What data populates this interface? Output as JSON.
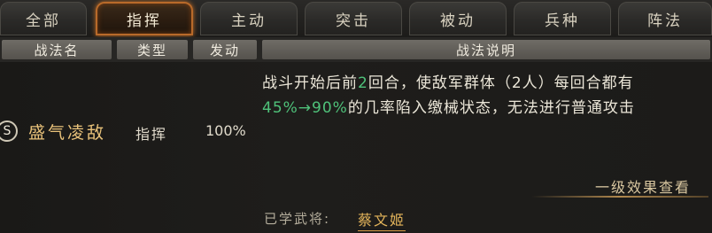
{
  "tabs": [
    {
      "label": "全部",
      "active": false
    },
    {
      "label": "指挥",
      "active": true
    },
    {
      "label": "主动",
      "active": false
    },
    {
      "label": "突击",
      "active": false
    },
    {
      "label": "被动",
      "active": false
    },
    {
      "label": "兵种",
      "active": false
    },
    {
      "label": "阵法",
      "active": false
    }
  ],
  "columns": {
    "name": "战法名",
    "type": "类型",
    "rate": "发动",
    "description": "战法说明"
  },
  "skill": {
    "grade": "S",
    "name": "盛气凌敌",
    "type": "指挥",
    "rate": "100%",
    "description": {
      "line1": "战斗开始后前",
      "rounds": "2",
      "line1_rest": "回合，使敌军群体（2人）每回合都有",
      "range": "45%→90%",
      "line2_rest": "的几率陷入缴械状态，无法进行普通攻击"
    }
  },
  "more_link": "一级效果查看",
  "learned": {
    "label": "已学武将:",
    "general": "蔡文姬"
  },
  "colors": {
    "accent": "#c46f28",
    "highlight_green": "#4fc27a",
    "skill_name": "#e9c27a"
  }
}
